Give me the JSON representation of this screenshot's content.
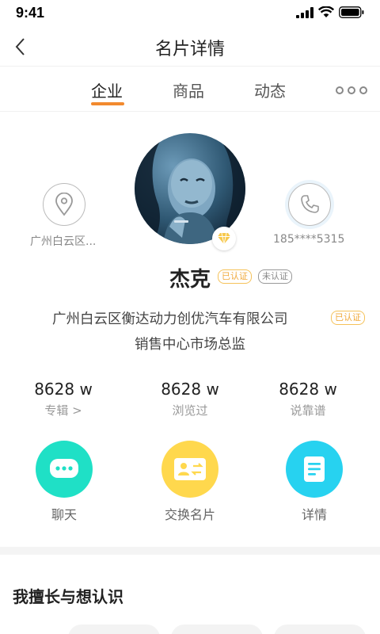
{
  "status_bar": {
    "time": "9:41"
  },
  "nav": {
    "title": "名片详情"
  },
  "tabs": [
    {
      "label": "企业",
      "active": true
    },
    {
      "label": "商品",
      "active": false
    },
    {
      "label": "动态",
      "active": false
    }
  ],
  "profile": {
    "location": "广州白云区...",
    "phone": "185****5315",
    "name": "杰克",
    "tag_verified": "已认证",
    "tag_unverified": "未认证",
    "company": "广州白云区衡达动力创优汽车有限公司",
    "company_tag": "已认证",
    "job_title": "销售中心市场总监"
  },
  "stats": [
    {
      "value": "8628 w",
      "label": "专辑 >"
    },
    {
      "value": "8628 w",
      "label": "浏览过"
    },
    {
      "value": "8628 w",
      "label": "说靠谱"
    }
  ],
  "actions": [
    {
      "label": "聊天",
      "color": "#1fe0c6",
      "icon": "chat-icon"
    },
    {
      "label": "交换名片",
      "color": "#ffd84d",
      "icon": "card-exchange-icon"
    },
    {
      "label": "详情",
      "color": "#27d2f0",
      "icon": "document-icon"
    }
  ],
  "section": {
    "title": "我擅长与想认识"
  },
  "colors": {
    "accent": "#f28a2e",
    "verified": "#f0a93a"
  }
}
